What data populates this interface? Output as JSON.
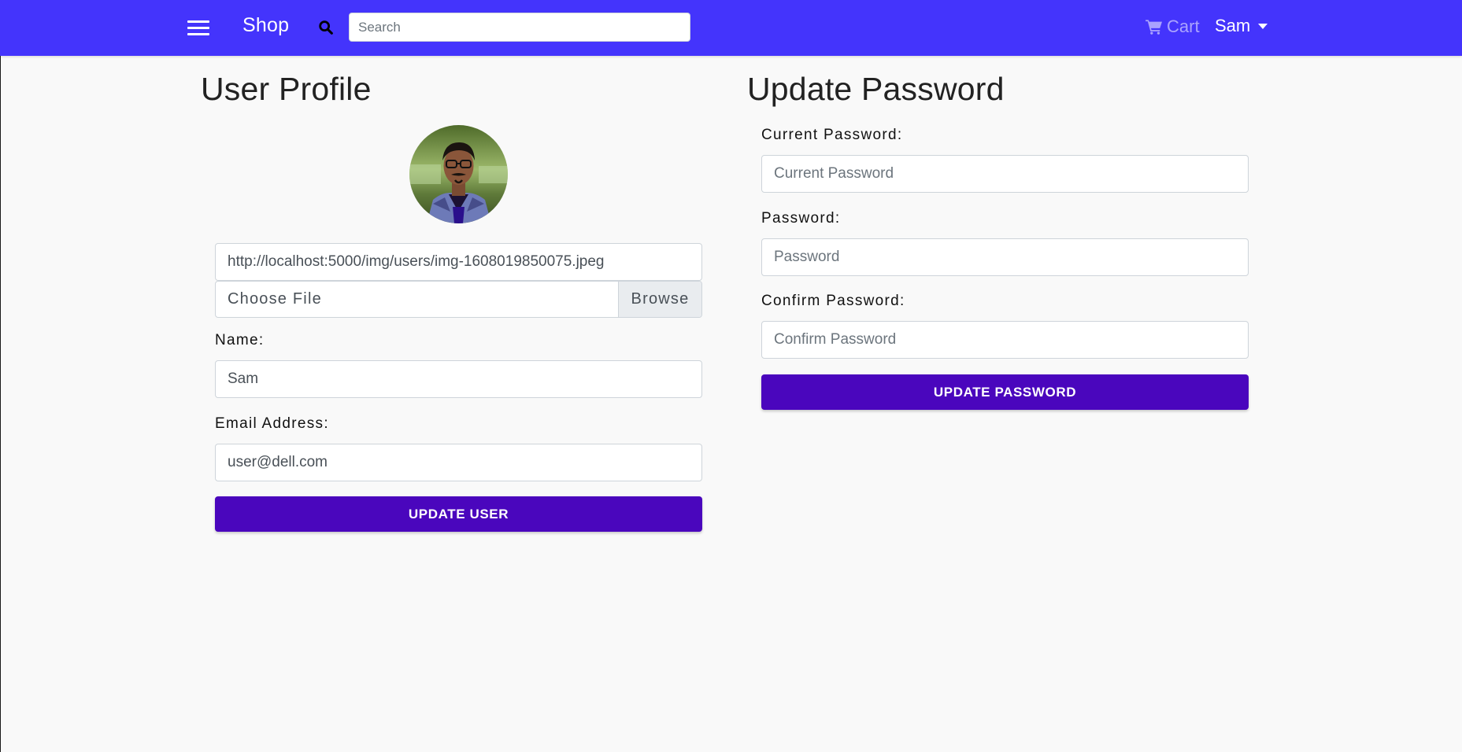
{
  "colors": {
    "navbar_bg": "#4434fc",
    "primary_button": "#4a06bd",
    "page_bg": "#f9f9f9"
  },
  "navbar": {
    "menu_icon": "hamburger-menu-icon",
    "brand": "Shop",
    "search_icon": "search-icon",
    "search": {
      "placeholder": "Search",
      "value": ""
    },
    "cart_icon": "shopping-cart-icon",
    "cart_label": "Cart",
    "user_name": "Sam"
  },
  "profile": {
    "title": "User Profile",
    "image_url": "http://localhost:5000/img/users/img-1608019850075.jpeg",
    "file_input": {
      "label": "Choose File",
      "browse": "Browse"
    },
    "name": {
      "label": "Name:",
      "value": "Sam"
    },
    "email": {
      "label": "Email Address:",
      "value": "user@dell.com"
    },
    "submit_label": "UPDATE USER"
  },
  "password": {
    "title": "Update Password",
    "current": {
      "label": "Current Password:",
      "placeholder": "Current Password"
    },
    "new": {
      "label": "Password:",
      "placeholder": "Password"
    },
    "confirm": {
      "label": "Confirm Password:",
      "placeholder": "Confirm Password"
    },
    "submit_label": "UPDATE PASSWORD"
  }
}
